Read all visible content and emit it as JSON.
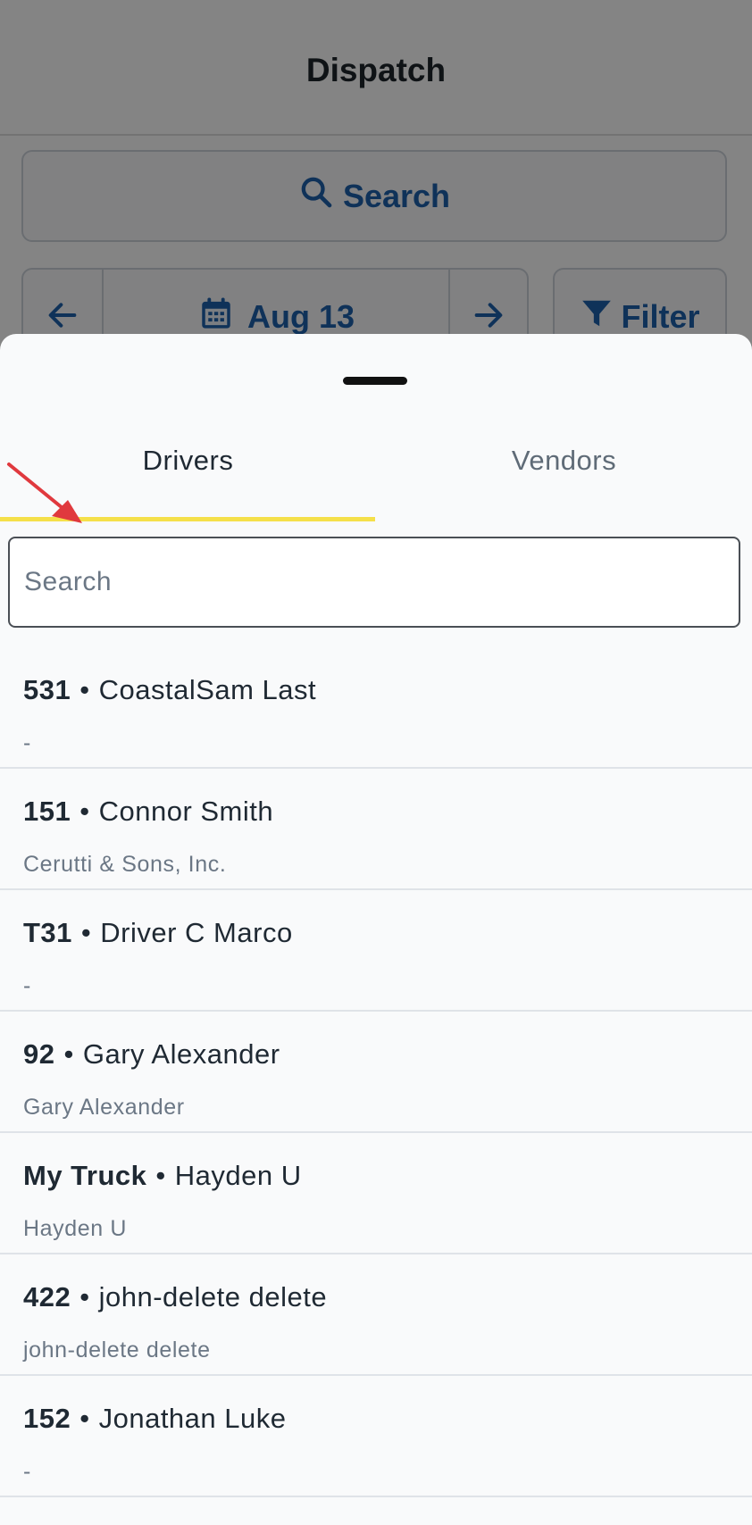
{
  "app": {
    "title": "Dispatch"
  },
  "toolbar": {
    "search_label": "Search",
    "date_label": "Aug 13",
    "filter_label": "Filter"
  },
  "sheet": {
    "tabs": [
      {
        "label": "Drivers",
        "active": true
      },
      {
        "label": "Vendors",
        "active": false
      }
    ],
    "search": {
      "placeholder": "Search",
      "value": ""
    },
    "drivers": [
      {
        "number": "531",
        "name": "CoastalSam Last",
        "company": "-"
      },
      {
        "number": "151",
        "name": "Connor Smith",
        "company": "Cerutti & Sons, Inc."
      },
      {
        "number": "T31",
        "name": "Driver C Marco",
        "company": "-"
      },
      {
        "number": "92",
        "name": "Gary Alexander",
        "company": "Gary Alexander"
      },
      {
        "number": "My Truck",
        "name": "Hayden U",
        "company": "Hayden U"
      },
      {
        "number": "422",
        "name": "john-delete delete",
        "company": "john-delete delete"
      },
      {
        "number": "152",
        "name": "Jonathan Luke",
        "company": "-"
      }
    ]
  },
  "colors": {
    "accent_blue": "#1e5fa8",
    "tab_indicator": "#f5e04a",
    "annotation_arrow": "#e0393e"
  },
  "icons": [
    "search-icon",
    "arrow-left-icon",
    "calendar-icon",
    "arrow-right-icon",
    "filter-icon"
  ]
}
